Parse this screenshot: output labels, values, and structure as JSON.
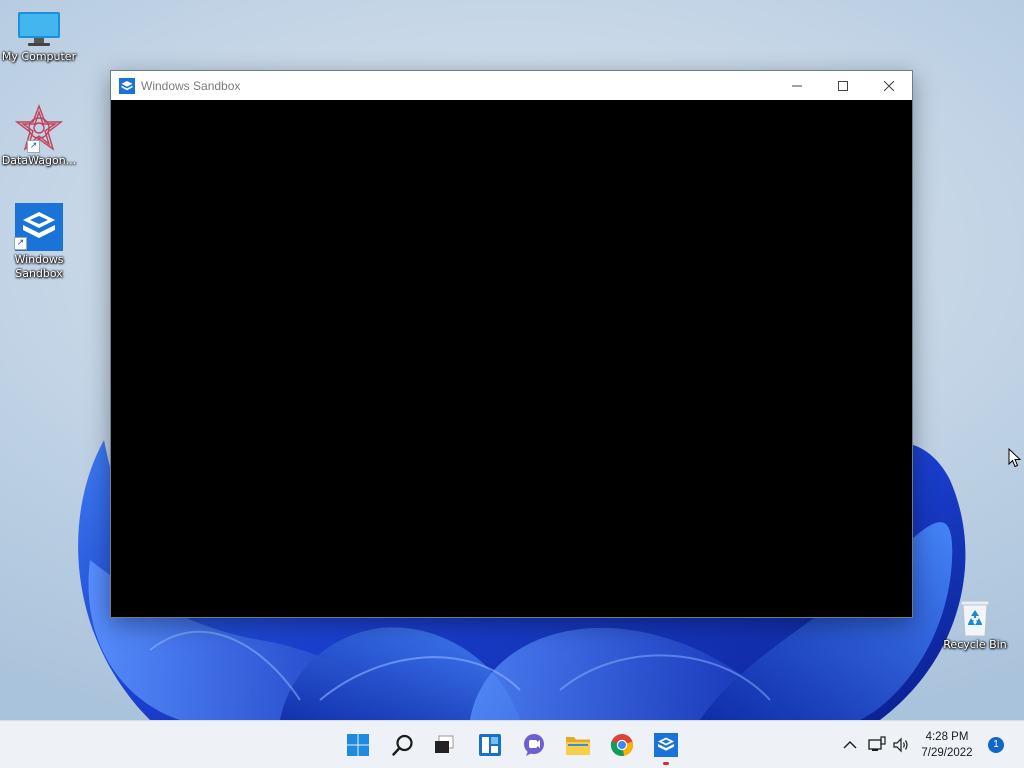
{
  "desktop": {
    "icons": [
      {
        "label": "My Computer"
      },
      {
        "label": "DataWagon..."
      },
      {
        "label": "Windows Sandbox"
      },
      {
        "label": "Recycle Bin"
      }
    ]
  },
  "window": {
    "title": "Windows Sandbox",
    "minimize_icon": "minimize-icon",
    "maximize_icon": "maximize-icon",
    "close_icon": "close-icon"
  },
  "taskbar": {
    "apps": [
      {
        "name": "start",
        "icon": "windows-logo-icon"
      },
      {
        "name": "search",
        "icon": "search-icon"
      },
      {
        "name": "task-view",
        "icon": "task-view-icon"
      },
      {
        "name": "widgets",
        "icon": "widgets-icon"
      },
      {
        "name": "chat",
        "icon": "chat-icon"
      },
      {
        "name": "file-explorer",
        "icon": "folder-icon"
      },
      {
        "name": "chrome",
        "icon": "chrome-icon"
      },
      {
        "name": "windows-sandbox",
        "icon": "sandbox-icon",
        "running": true
      }
    ],
    "tray": {
      "overflow_icon": "chevron-up-icon",
      "network_icon": "network-icon",
      "volume_icon": "volume-icon"
    },
    "clock": {
      "time": "4:28 PM",
      "date": "7/29/2022"
    },
    "notification_count": "1"
  },
  "colors": {
    "accent": "#1a73d9",
    "window_content": "#000000",
    "taskbar_bg": "#eef1f6",
    "bloom_blue": "#1f4fd6"
  }
}
